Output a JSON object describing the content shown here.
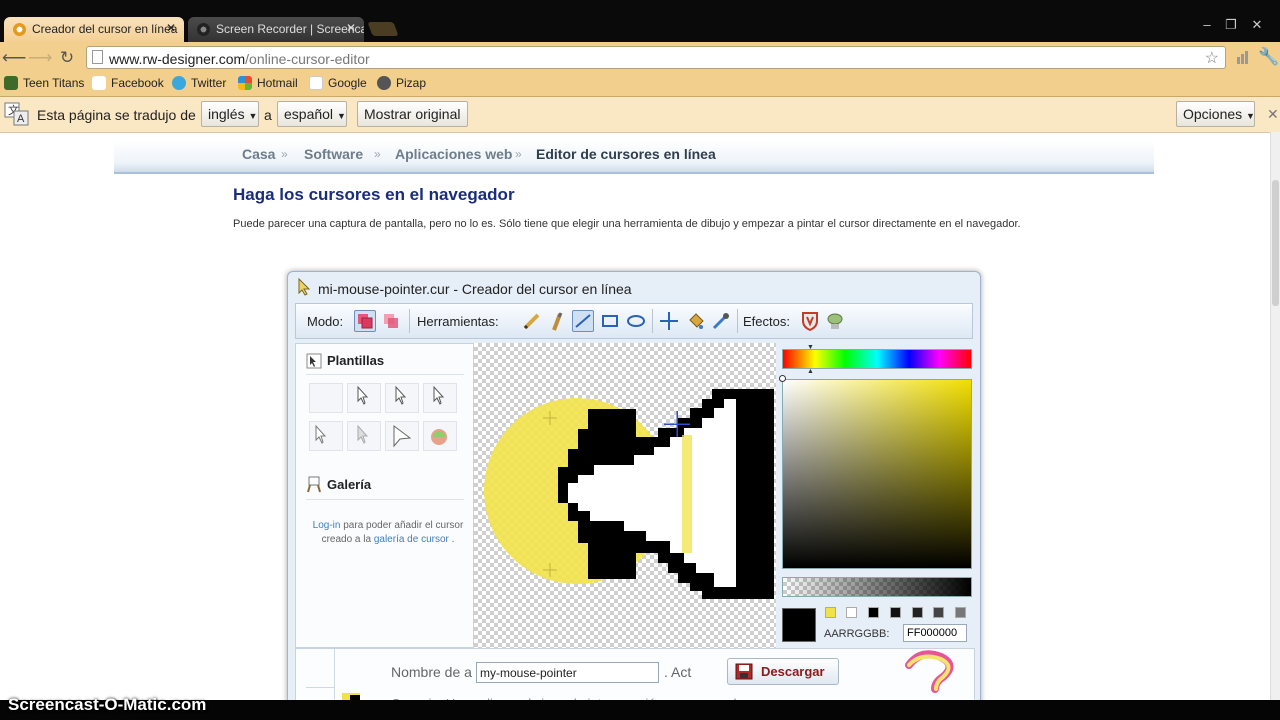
{
  "browser": {
    "tabs": [
      {
        "label": "Creador del cursor en línea",
        "active": true
      },
      {
        "label": "Screen Recorder | Screencast",
        "active": false
      }
    ],
    "url_host": "www.rw-designer.com",
    "url_path": "/online-cursor-editor",
    "bookmarks": [
      "Teen Titans",
      "Facebook",
      "Twitter",
      "Hotmail",
      "Google",
      "Pizap"
    ]
  },
  "translate_bar": {
    "text": "Esta página se tradujo de",
    "from_lang": "inglés",
    "connector": "a",
    "to_lang": "español",
    "show_original": "Mostrar original",
    "options": "Opciones"
  },
  "breadcrumb": [
    "Casa",
    "Software",
    "Aplicaciones web",
    "Editor de cursores en línea"
  ],
  "page": {
    "heading": "Haga los cursores en el navegador",
    "intro": "Puede parecer una captura de pantalla, pero no lo es. Sólo tiene que elegir una herramienta de dibujo y empezar a pintar el cursor directamente en el navegador."
  },
  "editor": {
    "title": "mi-mouse-pointer.cur - Creador del cursor en línea",
    "toolbar": {
      "mode_label": "Modo:",
      "tools_label": "Herramientas:",
      "effects_label": "Efectos:"
    },
    "templates_title": "Plantillas",
    "gallery_title": "Galería",
    "gallery_note": {
      "login": "Log-in",
      "text1": " para poder añadir el cursor creado a la ",
      "gallery_link": "galería de cursor",
      "text2": " ."
    },
    "color": {
      "label": "AARRGGBB:",
      "value": "FF000000"
    },
    "bottom": {
      "name_label": "Nombre de a",
      "name_value": "my-mouse-pointer",
      "act_label": ". Act",
      "download": "Descargar",
      "tip": "Consejo: Haga clic en el signo de interrogación para aprender a"
    }
  },
  "watermark": "Screencast-O-Matic.com",
  "colors": {
    "accent_yellow": "#f2e24a",
    "heading_blue": "#1a2d7c",
    "toolbar_orange": "#f2cf8c"
  }
}
